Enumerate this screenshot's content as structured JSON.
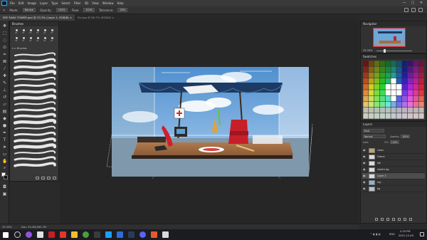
{
  "menu": {
    "items": [
      "File",
      "Edit",
      "Image",
      "Layer",
      "Type",
      "Select",
      "Filter",
      "3D",
      "View",
      "Window",
      "Help"
    ],
    "window_controls": [
      "—",
      "▢",
      "✕"
    ]
  },
  "options_bar": {
    "tool_preset": "",
    "mode_label": "Mode:",
    "mode_value": "Normal",
    "opacity_label": "Opacity:",
    "opacity_value": "100%",
    "flow_label": "Flow:",
    "flow_value": "100%",
    "tolerance_label": "Tolerance:",
    "tolerance_value": "20%"
  },
  "tabs": [
    {
      "label": "SEE SAKA TOWER.psd @ 33.3% (Layer 1, RGB/8) ×",
      "active": true
    },
    {
      "label": "file.jpg @ 66.7% (RGB/8) ×",
      "active": false
    }
  ],
  "brushes_panel": {
    "title": "Brushes",
    "sizes": [
      "30",
      "30",
      "30",
      "25",
      "25",
      "25",
      "36",
      "25",
      "36",
      "36",
      "36",
      "32"
    ],
    "group_label": "Brushes",
    "stroke_count": 19
  },
  "navigator_panel": {
    "title": "Navigator",
    "zoom": "33.33%"
  },
  "swatches_panel": {
    "title": "Swatches"
  },
  "layers_panel": {
    "title": "Layers",
    "kind_label": "Kind",
    "blend_value": "Normal",
    "opacity_label": "Opacity:",
    "opacity_value": "100%",
    "lock_label": "Lock:",
    "fill_label": "Fill:",
    "fill_value": "100%",
    "layers": [
      {
        "name": "clean",
        "active": false
      },
      {
        "name": "Frame",
        "active": false
      },
      {
        "name": "tall",
        "active": false
      },
      {
        "name": "sketch bg",
        "active": false
      },
      {
        "name": "Layer 1",
        "active": true
      },
      {
        "name": "sky",
        "active": false
      },
      {
        "name": "bg",
        "active": false
      }
    ]
  },
  "status_bar": {
    "zoom": "33.33%",
    "doc_info": "Doc: 50.3M/283.7M"
  },
  "taskbar": {
    "language": "ENG",
    "time": "2:20 PM",
    "date": "2021-12-09"
  },
  "colors": {
    "app_bg": "#2a2a2a",
    "panel_bg": "#323232",
    "accent_blue": "#31a8ff",
    "sky_blue": "#6fa7d8",
    "canopy_blue": "#1d3a63"
  }
}
